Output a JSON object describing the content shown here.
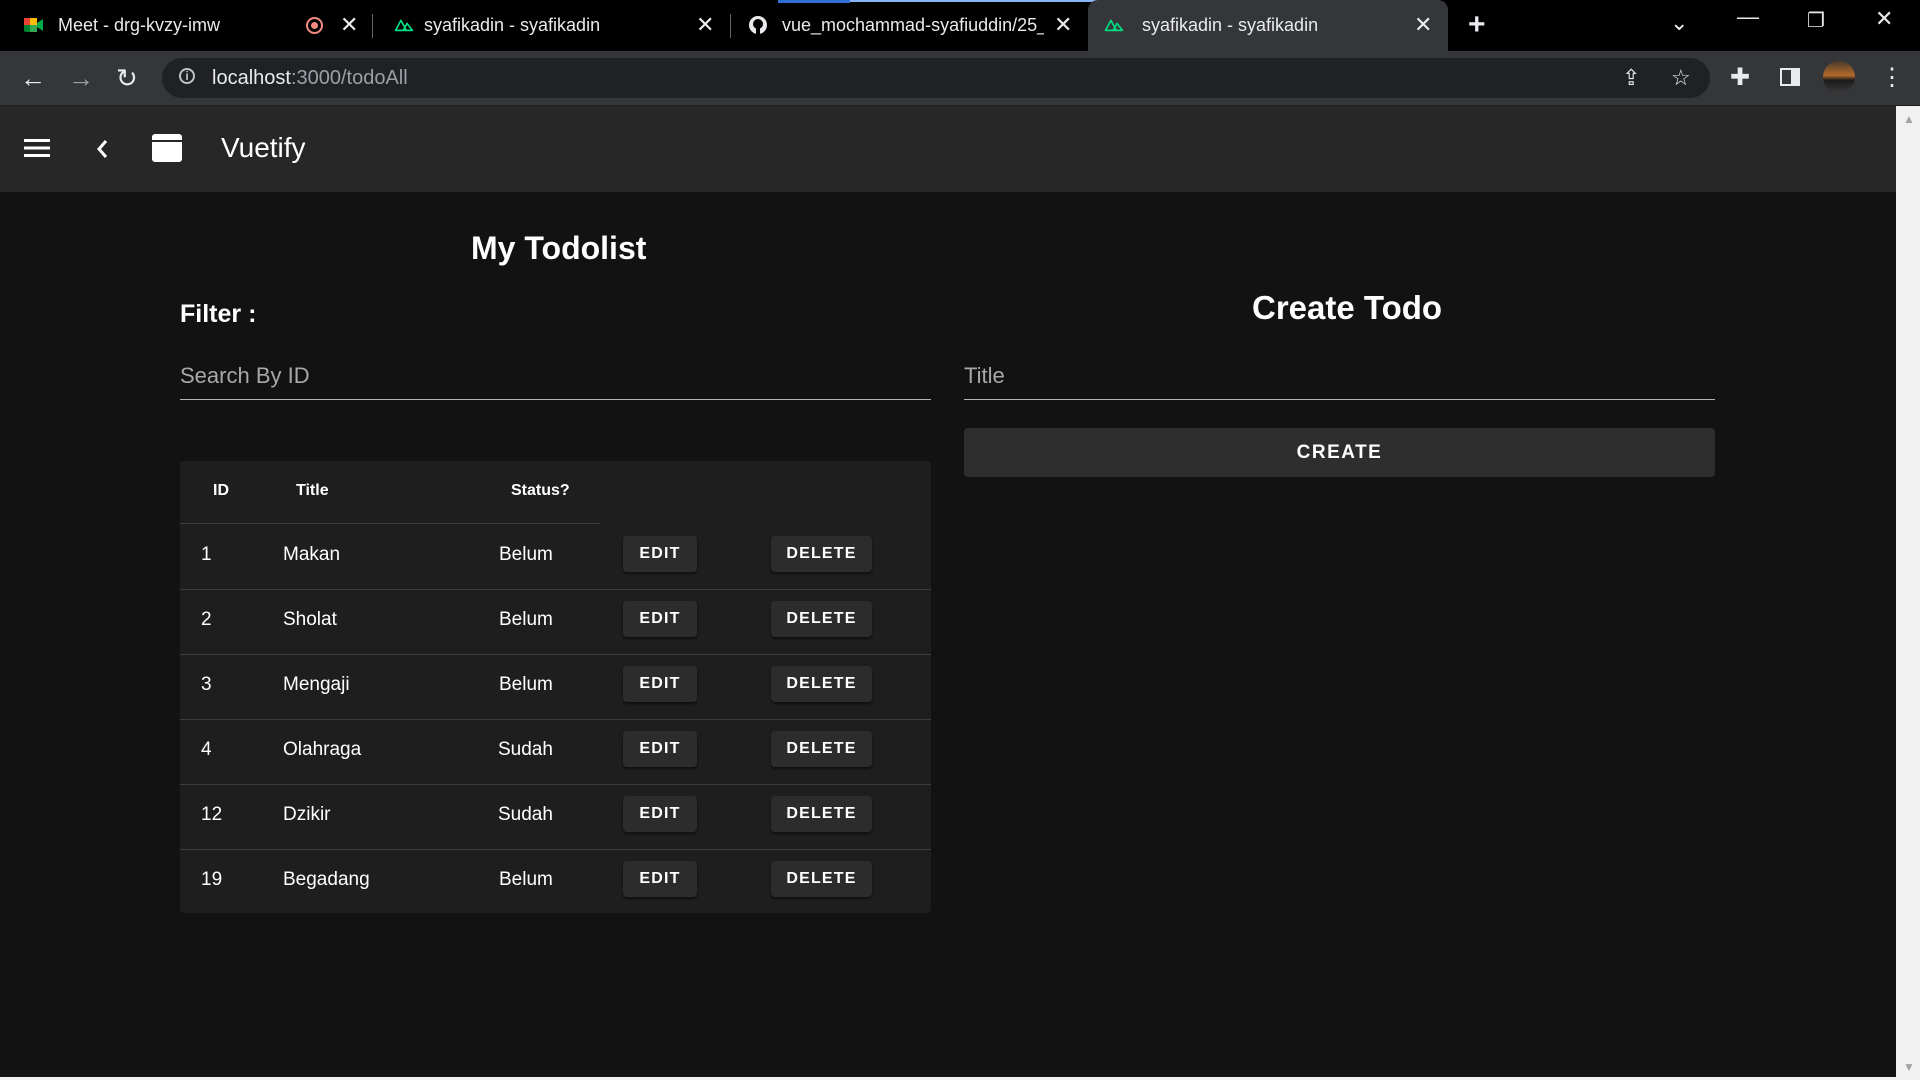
{
  "browser": {
    "tabs": [
      {
        "title": "Meet - drg-kvzy-imw"
      },
      {
        "title": "syafikadin - syafikadin"
      },
      {
        "title": "vue_mochammad-syafiuddin/25_"
      },
      {
        "title": "syafikadin - syafikadin"
      }
    ],
    "url_host": "localhost",
    "url_path": ":3000/todoAll"
  },
  "appbar": {
    "brand": "Vuetify"
  },
  "todolist": {
    "heading": "My Todolist",
    "filter_label": "Filter :",
    "search_placeholder": "Search By ID",
    "columns": {
      "id": "ID",
      "title": "Title",
      "status": "Status?"
    },
    "rows": [
      {
        "id": "1",
        "title": "Makan",
        "status": "Belum",
        "edit": "EDIT",
        "delete": "DELETE"
      },
      {
        "id": "2",
        "title": "Sholat",
        "status": "Belum",
        "edit": "EDIT",
        "delete": "DELETE"
      },
      {
        "id": "3",
        "title": "Mengaji",
        "status": "Belum",
        "edit": "EDIT",
        "delete": "DELETE"
      },
      {
        "id": "4",
        "title": "Olahraga",
        "status": "Sudah",
        "edit": "EDIT",
        "delete": "DELETE"
      },
      {
        "id": "12",
        "title": "Dzikir",
        "status": "Sudah",
        "edit": "EDIT",
        "delete": "DELETE"
      },
      {
        "id": "19",
        "title": "Begadang",
        "status": "Belum",
        "edit": "EDIT",
        "delete": "DELETE"
      }
    ]
  },
  "create": {
    "heading": "Create Todo",
    "title_placeholder": "Title",
    "button_label": "CREATE"
  },
  "colors": {
    "background": "#121212",
    "appbar": "#272727",
    "card": "#1e1e1e",
    "button": "#2e2e2e",
    "meet_recording": "#f28b82",
    "nuxt_green": "#00dc82"
  }
}
